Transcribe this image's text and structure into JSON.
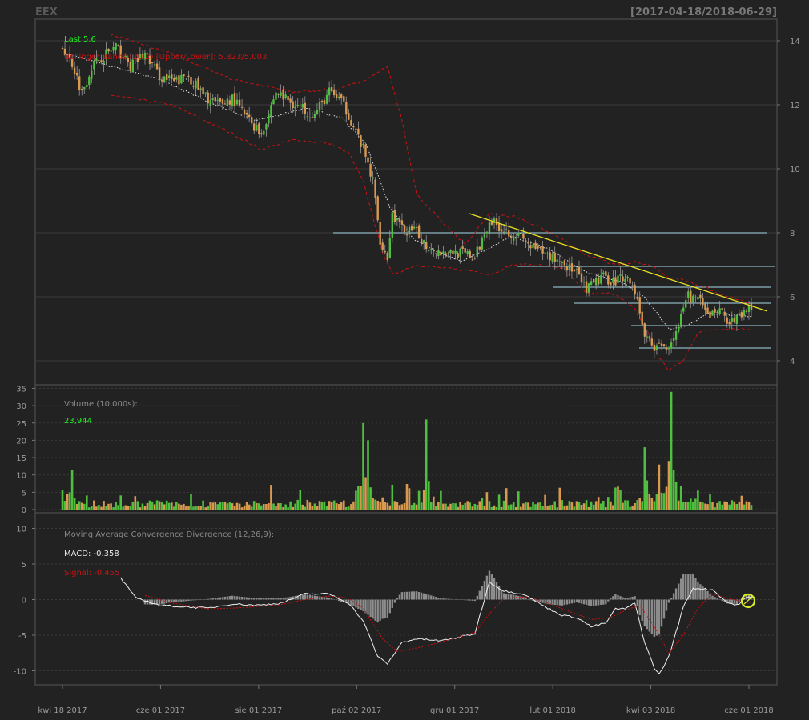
{
  "header": {
    "ticker": "EEX",
    "date_range": "[2017-04-18/2018-06-29]"
  },
  "colors": {
    "background": "#222222",
    "grid": "#3a3a3a",
    "axis_text": "#9a9a9a",
    "up": "#4fbf3f",
    "down": "#d99a50",
    "bbands": "#cc1111",
    "sma": "#e0e0e0",
    "support": "#a8d8e8",
    "trendline": "#e8e020",
    "macd": "#f0f0f0",
    "signal": "#cc1111",
    "hist": "#8c8c8c",
    "last": "#22ee22",
    "highlight": "#d8ee22"
  },
  "chart_data": [
    {
      "type": "candlestick",
      "panel": "price",
      "legend": {
        "last_label": "Last 5.6",
        "bbands_label": "Bollinger Bands (20,2) [Upper/Lower]: 5.823/5.003"
      },
      "ylim": [
        3.5,
        14.5
      ],
      "y_ticks": [
        "4",
        "6",
        "8",
        "10",
        "12",
        "14"
      ],
      "grid": true,
      "anchors": [
        [
          0,
          13.8
        ],
        [
          4,
          13.3
        ],
        [
          8,
          12.4
        ],
        [
          12,
          13.2
        ],
        [
          16,
          13.5
        ],
        [
          22,
          13.8
        ],
        [
          28,
          13.2
        ],
        [
          34,
          13.6
        ],
        [
          40,
          12.9
        ],
        [
          46,
          12.7
        ],
        [
          52,
          12.9
        ],
        [
          58,
          12.3
        ],
        [
          64,
          12.0
        ],
        [
          70,
          12.2
        ],
        [
          76,
          11.6
        ],
        [
          82,
          11.1
        ],
        [
          88,
          12.4
        ],
        [
          96,
          12.0
        ],
        [
          104,
          11.7
        ],
        [
          110,
          12.4
        ],
        [
          114,
          12.2
        ],
        [
          118,
          11.7
        ],
        [
          124,
          10.6
        ],
        [
          128,
          9.6
        ],
        [
          131,
          7.8
        ],
        [
          134,
          7.2
        ],
        [
          136,
          8.6
        ],
        [
          140,
          8.1
        ],
        [
          146,
          8.0
        ],
        [
          150,
          7.6
        ],
        [
          156,
          7.4
        ],
        [
          162,
          7.4
        ],
        [
          167,
          7.3
        ],
        [
          170,
          7.2
        ],
        [
          176,
          8.4
        ],
        [
          182,
          8.1
        ],
        [
          188,
          7.9
        ],
        [
          194,
          7.5
        ],
        [
          200,
          7.3
        ],
        [
          206,
          7.1
        ],
        [
          212,
          6.7
        ],
        [
          216,
          6.2
        ],
        [
          222,
          6.6
        ],
        [
          228,
          6.5
        ],
        [
          232,
          6.7
        ],
        [
          236,
          6.2
        ],
        [
          240,
          4.8
        ],
        [
          245,
          4.4
        ],
        [
          250,
          4.5
        ],
        [
          254,
          5.1
        ],
        [
          258,
          6.0
        ],
        [
          262,
          5.9
        ],
        [
          266,
          5.4
        ],
        [
          270,
          5.6
        ],
        [
          276,
          5.2
        ],
        [
          282,
          5.6
        ]
      ],
      "sma_anchors": [
        [
          1,
          13.6
        ],
        [
          20,
          13.2
        ],
        [
          40,
          12.8
        ],
        [
          60,
          12.1
        ],
        [
          80,
          11.5
        ],
        [
          100,
          11.9
        ],
        [
          115,
          11.6
        ],
        [
          125,
          10.8
        ],
        [
          135,
          8.8
        ],
        [
          145,
          7.8
        ],
        [
          155,
          7.4
        ],
        [
          165,
          7.1
        ],
        [
          175,
          7.5
        ],
        [
          185,
          7.9
        ],
        [
          200,
          7.5
        ],
        [
          215,
          6.8
        ],
        [
          232,
          6.4
        ],
        [
          240,
          6.0
        ],
        [
          250,
          5.0
        ],
        [
          258,
          5.1
        ],
        [
          266,
          5.5
        ],
        [
          282,
          5.4
        ]
      ],
      "bb_upper_anchors": [
        [
          20,
          14.2
        ],
        [
          45,
          13.6
        ],
        [
          70,
          12.8
        ],
        [
          95,
          12.4
        ],
        [
          115,
          12.5
        ],
        [
          128,
          12.9
        ],
        [
          134,
          13.2
        ],
        [
          140,
          11.5
        ],
        [
          146,
          9.2
        ],
        [
          156,
          8.4
        ],
        [
          166,
          7.6
        ],
        [
          176,
          8.6
        ],
        [
          186,
          8.5
        ],
        [
          196,
          8.2
        ],
        [
          206,
          7.8
        ],
        [
          216,
          7.3
        ],
        [
          228,
          7.0
        ],
        [
          236,
          7.1
        ],
        [
          242,
          7.0
        ],
        [
          250,
          6.6
        ],
        [
          258,
          6.5
        ],
        [
          268,
          6.2
        ],
        [
          282,
          5.8
        ]
      ],
      "bb_lower_anchors": [
        [
          20,
          12.3
        ],
        [
          45,
          12.0
        ],
        [
          70,
          11.1
        ],
        [
          82,
          10.6
        ],
        [
          95,
          10.9
        ],
        [
          110,
          10.8
        ],
        [
          118,
          10.5
        ],
        [
          124,
          9.6
        ],
        [
          132,
          7.4
        ],
        [
          136,
          6.7
        ],
        [
          146,
          7.0
        ],
        [
          156,
          6.9
        ],
        [
          170,
          6.8
        ],
        [
          176,
          6.7
        ],
        [
          186,
          7.0
        ],
        [
          196,
          7.0
        ],
        [
          206,
          6.9
        ],
        [
          216,
          6.1
        ],
        [
          228,
          6.1
        ],
        [
          236,
          5.6
        ],
        [
          242,
          4.8
        ],
        [
          246,
          4.1
        ],
        [
          250,
          3.7
        ],
        [
          256,
          4.0
        ],
        [
          262,
          4.9
        ],
        [
          270,
          5.0
        ],
        [
          282,
          5.0
        ]
      ],
      "support_levels": [
        8.0,
        6.95,
        6.3,
        5.8,
        5.1,
        4.4
      ],
      "trendline": [
        [
          5.4,
          8.6
        ],
        [
          938,
          5.55
        ]
      ]
    },
    {
      "type": "bar",
      "panel": "volume",
      "legend": {
        "title": "Volume (10,000s):",
        "value": "23,944"
      },
      "ylim": [
        0,
        35
      ],
      "y_ticks": [
        "0",
        "5",
        "10",
        "15",
        "20",
        "25",
        "30",
        "35"
      ],
      "spikes": [
        [
          4,
          11.5
        ],
        [
          124,
          25
        ],
        [
          126,
          20
        ],
        [
          150,
          26
        ],
        [
          240,
          18
        ],
        [
          246,
          13
        ],
        [
          251,
          34
        ],
        [
          262,
          5.5
        ],
        [
          280,
          4.0
        ]
      ]
    },
    {
      "type": "line",
      "panel": "macd",
      "legend": {
        "title": "Moving Average Convergence Divergence (12,26,9):",
        "macd_label": "MACD: -0.358",
        "signal_label": "Signal: -0.455"
      },
      "ylim": [
        -11,
        11
      ],
      "y_ticks": [
        "-10",
        "-5",
        "0",
        "5",
        "10"
      ],
      "macd_anchors": [
        [
          24,
          3.0
        ],
        [
          30,
          0.3
        ],
        [
          40,
          -0.8
        ],
        [
          60,
          -1.2
        ],
        [
          70,
          -0.6
        ],
        [
          80,
          -0.8
        ],
        [
          90,
          -0.5
        ],
        [
          100,
          0.8
        ],
        [
          110,
          0.8
        ],
        [
          118,
          -0.5
        ],
        [
          124,
          -3.0
        ],
        [
          130,
          -8.0
        ],
        [
          134,
          -9.0
        ],
        [
          140,
          -6.0
        ],
        [
          146,
          -5.5
        ],
        [
          156,
          -5.8
        ],
        [
          170,
          -4.8
        ],
        [
          176,
          2.5
        ],
        [
          182,
          1.2
        ],
        [
          190,
          0.8
        ],
        [
          200,
          -1.2
        ],
        [
          206,
          -2.2
        ],
        [
          212,
          -2.5
        ],
        [
          218,
          -3.8
        ],
        [
          224,
          -3.3
        ],
        [
          228,
          -1.3
        ],
        [
          232,
          -1.3
        ],
        [
          236,
          -0.5
        ],
        [
          240,
          -6.0
        ],
        [
          244,
          -9.6
        ],
        [
          246,
          -10.5
        ],
        [
          250,
          -8.0
        ],
        [
          256,
          -1.0
        ],
        [
          260,
          1.6
        ],
        [
          268,
          1.4
        ],
        [
          274,
          -0.4
        ],
        [
          278,
          -0.8
        ],
        [
          282,
          0.3
        ]
      ],
      "signal_anchors": [
        [
          34,
          0.6
        ],
        [
          44,
          -0.4
        ],
        [
          60,
          -1.3
        ],
        [
          70,
          -1.2
        ],
        [
          80,
          -1.0
        ],
        [
          90,
          -0.7
        ],
        [
          100,
          0.0
        ],
        [
          110,
          0.5
        ],
        [
          118,
          0.2
        ],
        [
          124,
          -1.2
        ],
        [
          132,
          -5.5
        ],
        [
          138,
          -7.3
        ],
        [
          146,
          -6.8
        ],
        [
          156,
          -6.0
        ],
        [
          170,
          -4.6
        ],
        [
          176,
          -2.0
        ],
        [
          182,
          0.2
        ],
        [
          192,
          0.4
        ],
        [
          200,
          -0.5
        ],
        [
          210,
          -1.8
        ],
        [
          218,
          -2.8
        ],
        [
          226,
          -2.5
        ],
        [
          232,
          -1.5
        ],
        [
          238,
          -0.8
        ],
        [
          244,
          -3.8
        ],
        [
          250,
          -7.5
        ],
        [
          256,
          -5.0
        ],
        [
          262,
          -1.2
        ],
        [
          268,
          0.8
        ],
        [
          274,
          0.2
        ],
        [
          282,
          -0.4
        ]
      ]
    }
  ],
  "x_axis": {
    "tick_labels": [
      "kwi 18 2017",
      "cze 01 2017",
      "sie 01 2017",
      "paź 02 2017",
      "gru 01 2017",
      "lut 01 2018",
      "kwi 03 2018",
      "cze 01 2018"
    ]
  }
}
